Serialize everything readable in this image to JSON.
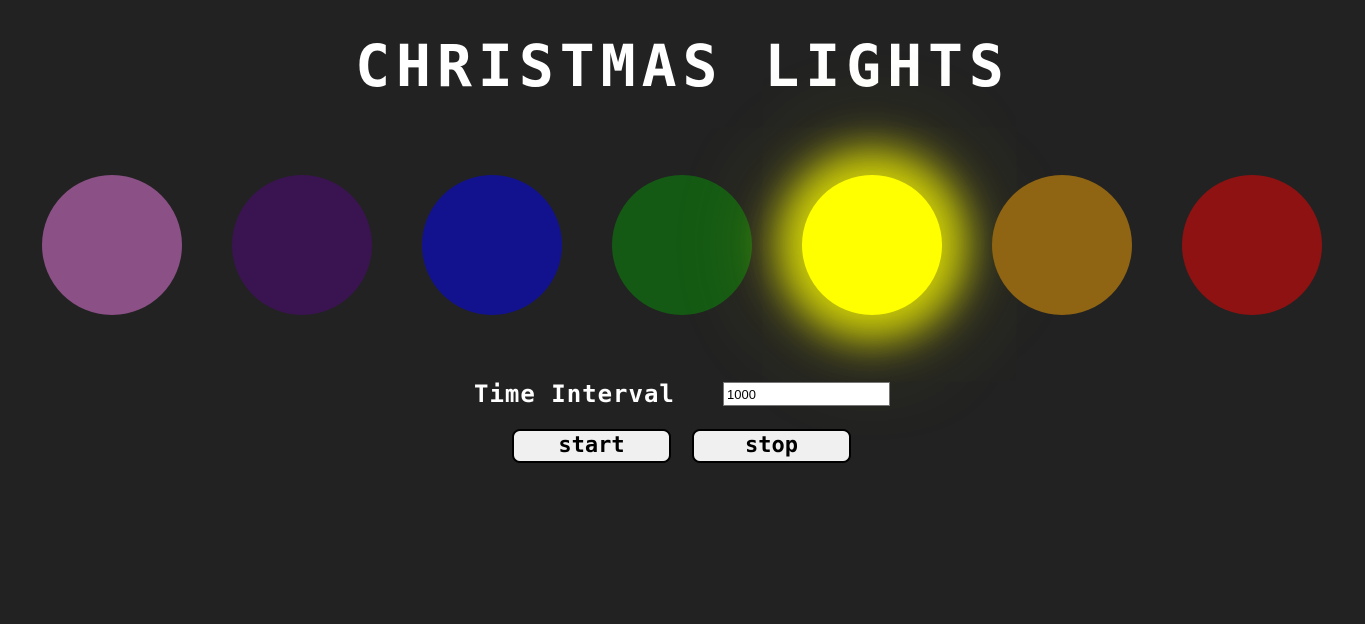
{
  "title": "CHRISTMAS LIGHTS",
  "lights": [
    {
      "name": "light-purple-pink",
      "color": "#8b5086",
      "on": false
    },
    {
      "name": "light-dark-purple",
      "color": "#3a1450",
      "on": false
    },
    {
      "name": "light-blue",
      "color": "#12128e",
      "on": false
    },
    {
      "name": "light-green",
      "color": "#145a14",
      "on": false
    },
    {
      "name": "light-yellow",
      "color": "#ffff00",
      "on": true
    },
    {
      "name": "light-orange",
      "color": "#8f6412",
      "on": false
    },
    {
      "name": "light-red",
      "color": "#8e1212",
      "on": false
    }
  ],
  "controls": {
    "interval_label": "Time Interval",
    "interval_value": "1000",
    "start_label": "start",
    "stop_label": "stop"
  }
}
